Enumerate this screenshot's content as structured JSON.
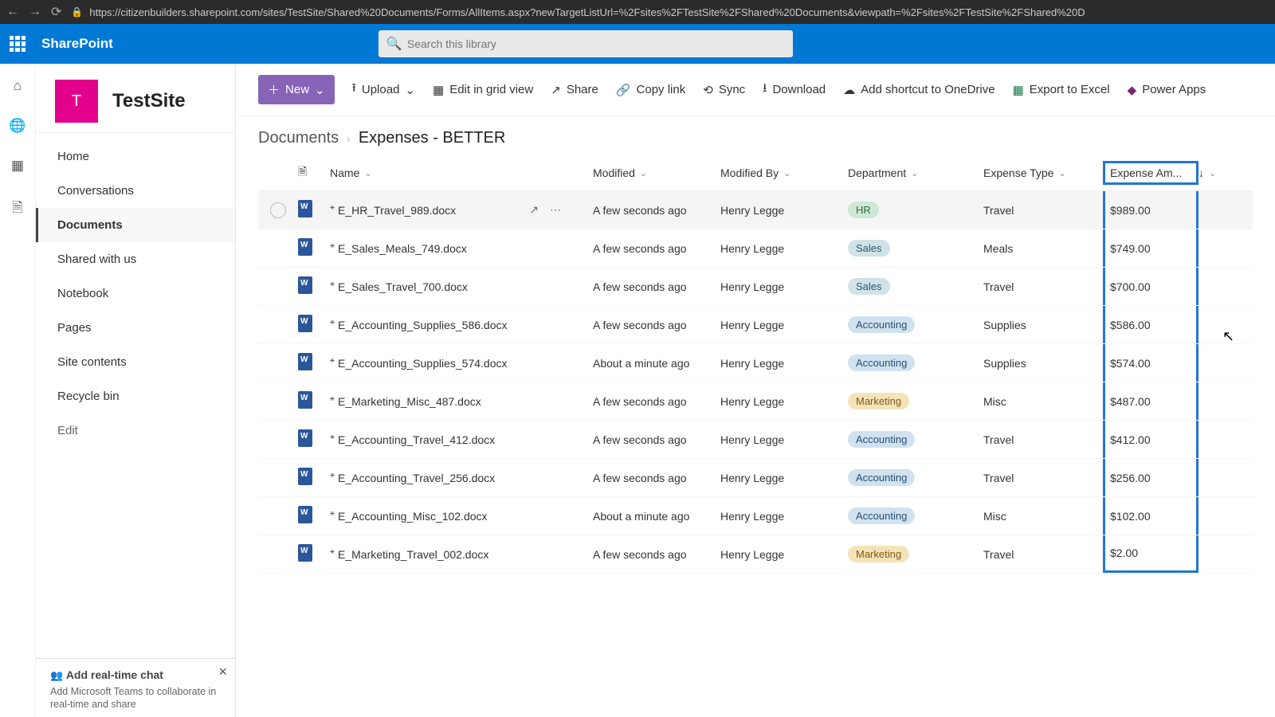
{
  "browser": {
    "url": "https://citizenbuilders.sharepoint.com/sites/TestSite/Shared%20Documents/Forms/AllItems.aspx?newTargetListUrl=%2Fsites%2FTestSite%2FShared%20Documents&viewpath=%2Fsites%2FTestSite%2FShared%20D"
  },
  "suite": {
    "product": "SharePoint",
    "search_placeholder": "Search this library"
  },
  "site": {
    "logo_letter": "T",
    "name": "TestSite"
  },
  "nav": {
    "items": [
      "Home",
      "Conversations",
      "Documents",
      "Shared with us",
      "Notebook",
      "Pages",
      "Site contents",
      "Recycle bin"
    ],
    "edit": "Edit",
    "active_index": 2
  },
  "promo": {
    "title": "Add real-time chat",
    "desc": "Add Microsoft Teams to collaborate in real-time and share"
  },
  "commands": {
    "new": "New",
    "upload": "Upload",
    "edit_grid": "Edit in grid view",
    "share": "Share",
    "copy_link": "Copy link",
    "sync": "Sync",
    "download": "Download",
    "shortcut": "Add shortcut to OneDrive",
    "export": "Export to Excel",
    "power": "Power Apps"
  },
  "breadcrumb": {
    "parent": "Documents",
    "current": "Expenses - BETTER"
  },
  "columns": {
    "name": "Name",
    "modified": "Modified",
    "modified_by": "Modified By",
    "department": "Department",
    "expense_type": "Expense Type",
    "expense_amount": "Expense Am..."
  },
  "rows": [
    {
      "name": "E_HR_Travel_989.docx",
      "modified": "A few seconds ago",
      "by": "Henry Legge",
      "dept": "HR",
      "type": "Travel",
      "amount": "$989.00"
    },
    {
      "name": "E_Sales_Meals_749.docx",
      "modified": "A few seconds ago",
      "by": "Henry Legge",
      "dept": "Sales",
      "type": "Meals",
      "amount": "$749.00"
    },
    {
      "name": "E_Sales_Travel_700.docx",
      "modified": "A few seconds ago",
      "by": "Henry Legge",
      "dept": "Sales",
      "type": "Travel",
      "amount": "$700.00"
    },
    {
      "name": "E_Accounting_Supplies_586.docx",
      "modified": "A few seconds ago",
      "by": "Henry Legge",
      "dept": "Accounting",
      "type": "Supplies",
      "amount": "$586.00"
    },
    {
      "name": "E_Accounting_Supplies_574.docx",
      "modified": "About a minute ago",
      "by": "Henry Legge",
      "dept": "Accounting",
      "type": "Supplies",
      "amount": "$574.00"
    },
    {
      "name": "E_Marketing_Misc_487.docx",
      "modified": "A few seconds ago",
      "by": "Henry Legge",
      "dept": "Marketing",
      "type": "Misc",
      "amount": "$487.00"
    },
    {
      "name": "E_Accounting_Travel_412.docx",
      "modified": "A few seconds ago",
      "by": "Henry Legge",
      "dept": "Accounting",
      "type": "Travel",
      "amount": "$412.00"
    },
    {
      "name": "E_Accounting_Travel_256.docx",
      "modified": "A few seconds ago",
      "by": "Henry Legge",
      "dept": "Accounting",
      "type": "Travel",
      "amount": "$256.00"
    },
    {
      "name": "E_Accounting_Misc_102.docx",
      "modified": "About a minute ago",
      "by": "Henry Legge",
      "dept": "Accounting",
      "type": "Misc",
      "amount": "$102.00"
    },
    {
      "name": "E_Marketing_Travel_002.docx",
      "modified": "A few seconds ago",
      "by": "Henry Legge",
      "dept": "Marketing",
      "type": "Travel",
      "amount": "$2.00"
    }
  ]
}
